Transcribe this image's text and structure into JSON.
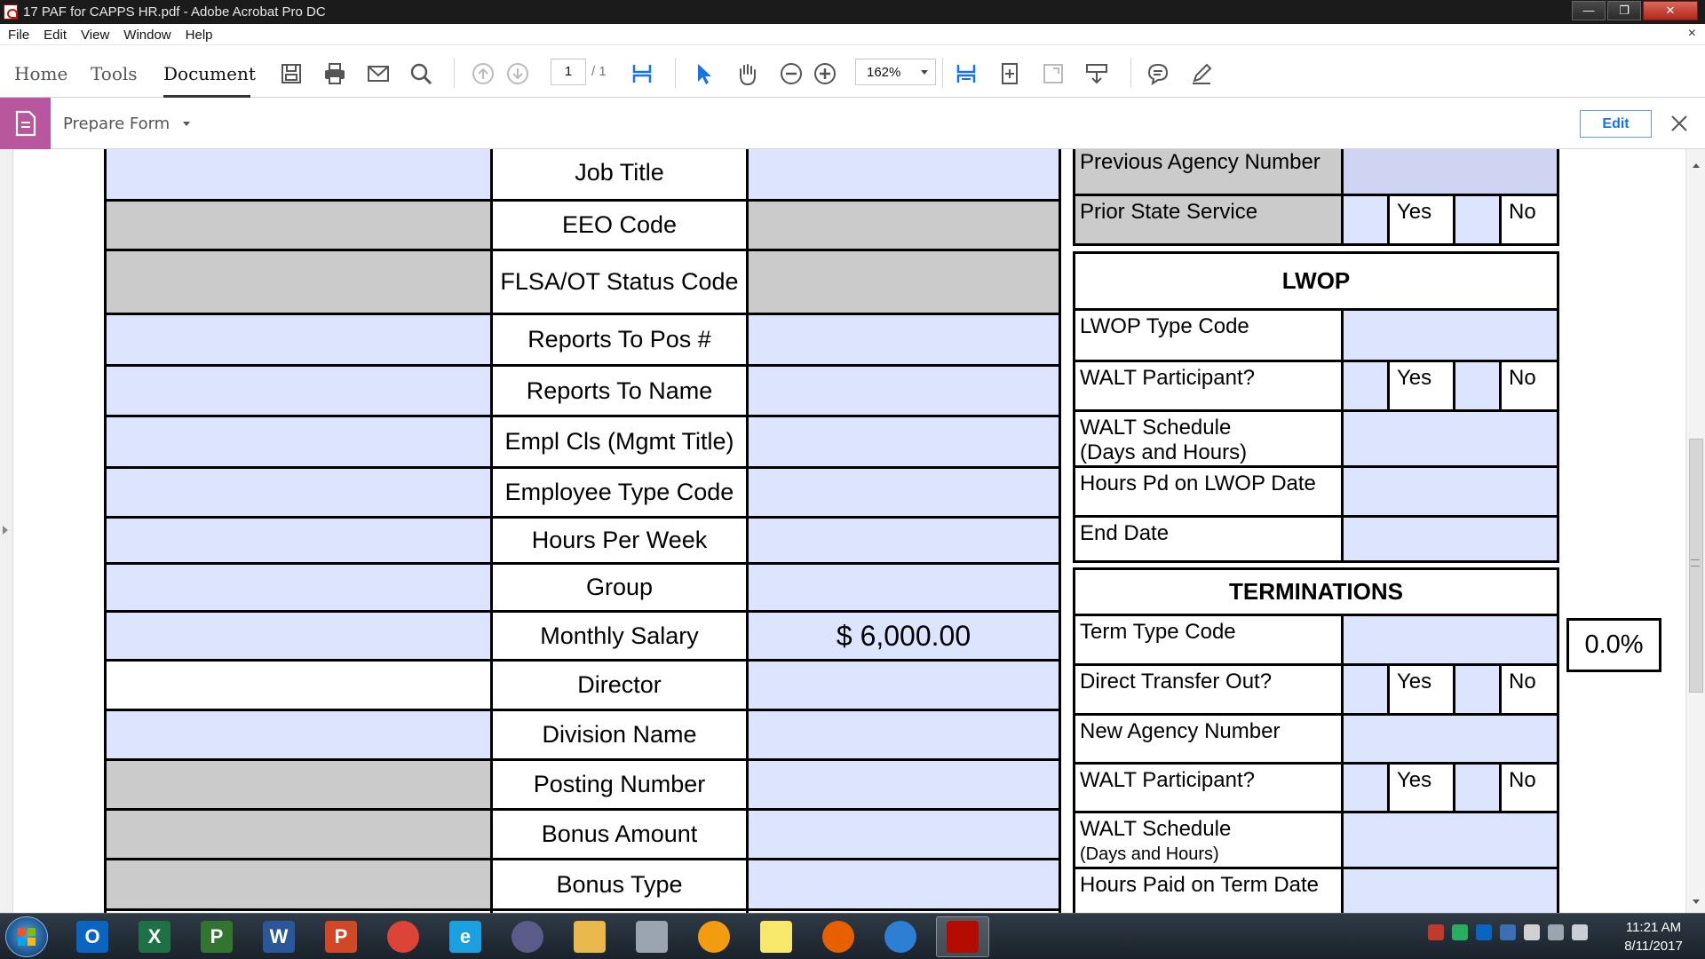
{
  "window": {
    "title": "17 PAF for CAPPS HR.pdf - Adobe Acrobat Pro DC",
    "min_glyph": "—",
    "max_glyph": "❐",
    "close_glyph": "✕"
  },
  "menu": {
    "items": [
      "File",
      "Edit",
      "View",
      "Window",
      "Help"
    ],
    "close_glyph": "×"
  },
  "toolbar": {
    "tabs": [
      "Home",
      "Tools",
      "Document"
    ],
    "page_current": "1",
    "page_total": "/ 1",
    "zoom": "162%"
  },
  "prepare_form": {
    "label": "Prepare Form",
    "edit_label": "Edit"
  },
  "left_table": {
    "rows": [
      {
        "label": "Job Title",
        "value": ""
      },
      {
        "label": "EEO Code",
        "value": ""
      },
      {
        "label": "FLSA/OT Status Code",
        "value": ""
      },
      {
        "label": "Reports To Pos #",
        "value": ""
      },
      {
        "label": "Reports To Name",
        "value": ""
      },
      {
        "label": "Empl Cls (Mgmt Title)",
        "value": ""
      },
      {
        "label": "Employee Type Code",
        "value": ""
      },
      {
        "label": "Hours Per Week",
        "value": ""
      },
      {
        "label": "Group",
        "value": ""
      },
      {
        "label": "Monthly Salary",
        "value": "$ 6,000.00"
      },
      {
        "label": "Director",
        "value": ""
      },
      {
        "label": "Division Name",
        "value": ""
      },
      {
        "label": "Posting Number",
        "value": ""
      },
      {
        "label": "Bonus Amount",
        "value": ""
      },
      {
        "label": "Bonus Type",
        "value": ""
      }
    ]
  },
  "right_table": {
    "previous_agency_number": "Previous Agency Number",
    "prior_state_service": "Prior State Service",
    "yes": "Yes",
    "no": "No",
    "lwop_header": "LWOP",
    "lwop_type_code": "LWOP Type Code",
    "walt_participant": "WALT Participant?",
    "walt_schedule_line1": "WALT Schedule",
    "walt_schedule_line2": "(Days and Hours)",
    "hours_pd_lwop": "Hours Pd on LWOP Date",
    "end_date": "End Date",
    "terminations_header": "TERMINATIONS",
    "term_type_code": "Term Type Code",
    "direct_transfer_out": "Direct Transfer Out?",
    "new_agency_number": "New Agency Number",
    "hours_paid_term": "Hours Paid on Term Date"
  },
  "percent_box": "0.0%",
  "clock": {
    "time": "11:21 AM",
    "date": "8/11/2017"
  },
  "taskbar_apps": [
    {
      "name": "outlook",
      "glyph": "O",
      "color": "#0a64c2"
    },
    {
      "name": "excel",
      "glyph": "X",
      "color": "#1e7145"
    },
    {
      "name": "project",
      "glyph": "P",
      "color": "#31752f"
    },
    {
      "name": "word",
      "glyph": "W",
      "color": "#2b579a"
    },
    {
      "name": "powerpoint",
      "glyph": "P",
      "color": "#d24726"
    },
    {
      "name": "chrome",
      "glyph": "",
      "color": "#db4437"
    },
    {
      "name": "internet-explorer",
      "glyph": "e",
      "color": "#1ba1e2"
    },
    {
      "name": "app-swirl",
      "glyph": "",
      "color": "#5b5b8a"
    },
    {
      "name": "file-explorer",
      "glyph": "",
      "color": "#e8b84a"
    },
    {
      "name": "calculator",
      "glyph": "",
      "color": "#9aa5b1"
    },
    {
      "name": "app-orange",
      "glyph": "",
      "color": "#f39c12"
    },
    {
      "name": "sticky-notes",
      "glyph": "",
      "color": "#f7e86b"
    },
    {
      "name": "firefox",
      "glyph": "",
      "color": "#e66000"
    },
    {
      "name": "app-blue-swirl",
      "glyph": "",
      "color": "#2d7fd3"
    },
    {
      "name": "acrobat",
      "glyph": "",
      "color": "#b30b00"
    }
  ]
}
